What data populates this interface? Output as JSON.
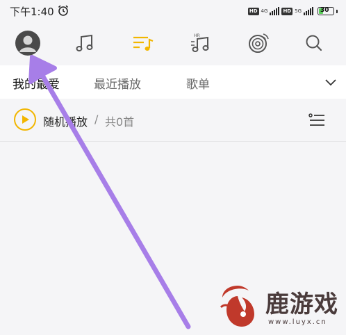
{
  "status_bar": {
    "time": "下午1:40",
    "hd_1": "HD",
    "net_1": "4G",
    "hd_2": "HD",
    "net_2": "5G",
    "battery": "30",
    "battery_level": 0.3
  },
  "top_nav": {
    "icons": [
      "avatar-icon",
      "music-note-icon",
      "playlist-icon",
      "hr-music-icon",
      "radio-disc-icon",
      "search-icon"
    ],
    "active_color": "#f2b600"
  },
  "tabs": [
    {
      "label": "我的最爱",
      "active": true
    },
    {
      "label": "最近播放",
      "active": false
    },
    {
      "label": "歌单",
      "active": false
    }
  ],
  "playbar": {
    "shuffle_label": "随机播放",
    "separator": "/",
    "count": "共0首"
  },
  "watermark": {
    "text": "鹿游戏",
    "url": "www.luyx.cn"
  },
  "colors": {
    "accent": "#f2b600",
    "arrow": "#a77ee8"
  }
}
